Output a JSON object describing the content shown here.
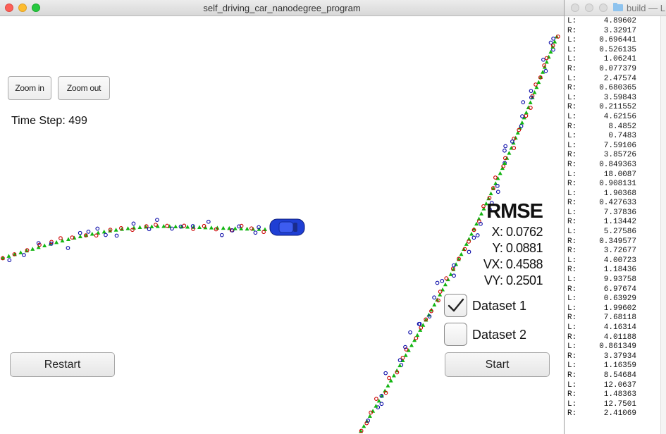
{
  "simulator": {
    "title": "self_driving_car_nanodegree_program",
    "zoom_in_label": "Zoom in",
    "zoom_out_label": "Zoom out",
    "time_step": "Time Step: 499",
    "rmse": {
      "title": "RMSE",
      "x": "X: 0.0762",
      "y": "Y: 0.0881",
      "vx": "VX: 0.4588",
      "vy": "VY: 0.2501"
    },
    "dataset1": {
      "label": "Dataset 1",
      "checked": true
    },
    "dataset2": {
      "label": "Dataset 2",
      "checked": false
    },
    "restart_label": "Restart",
    "start_label": "Start",
    "colors": {
      "lidar": "#cc0000",
      "radar": "#0a0aa8",
      "estimate": "#12b512",
      "car": "#1f3fd4"
    }
  },
  "terminal": {
    "title": "build — L",
    "lines": [
      [
        "L:",
        "4.89602"
      ],
      [
        "R:",
        "3.32917"
      ],
      [
        "L:",
        "0.696441"
      ],
      [
        "L:",
        "0.526135"
      ],
      [
        "L:",
        "1.06241"
      ],
      [
        "R:",
        "0.077379"
      ],
      [
        "L:",
        "2.47574"
      ],
      [
        "R:",
        "0.680365"
      ],
      [
        "L:",
        "3.59843"
      ],
      [
        "R:",
        "0.211552"
      ],
      [
        "L:",
        "4.62156"
      ],
      [
        "R:",
        "8.4852"
      ],
      [
        "L:",
        "0.7483"
      ],
      [
        "L:",
        "7.59106"
      ],
      [
        "R:",
        "3.85726"
      ],
      [
        "R:",
        "0.849363"
      ],
      [
        "L:",
        "18.0087"
      ],
      [
        "R:",
        "0.908131"
      ],
      [
        "L:",
        "1.90368"
      ],
      [
        "R:",
        "0.427633"
      ],
      [
        "L:",
        "7.37836"
      ],
      [
        "R:",
        "1.13442"
      ],
      [
        "L:",
        "5.27586"
      ],
      [
        "R:",
        "0.349577"
      ],
      [
        "R:",
        "3.72677"
      ],
      [
        "L:",
        "4.00723"
      ],
      [
        "R:",
        "1.18436"
      ],
      [
        "L:",
        "9.93758"
      ],
      [
        "R:",
        "6.97674"
      ],
      [
        "L:",
        "0.63929"
      ],
      [
        "L:",
        "1.99602"
      ],
      [
        "R:",
        "7.68118"
      ],
      [
        "L:",
        "4.16314"
      ],
      [
        "R:",
        "4.01188"
      ],
      [
        "L:",
        "0.861349"
      ],
      [
        "R:",
        "3.37934"
      ],
      [
        "L:",
        "1.16359"
      ],
      [
        "R:",
        "8.54684"
      ],
      [
        "L:",
        "12.0637"
      ],
      [
        "R:",
        "1.48363"
      ],
      [
        "L:",
        "12.7501"
      ],
      [
        "R:",
        "2.41069"
      ]
    ]
  }
}
